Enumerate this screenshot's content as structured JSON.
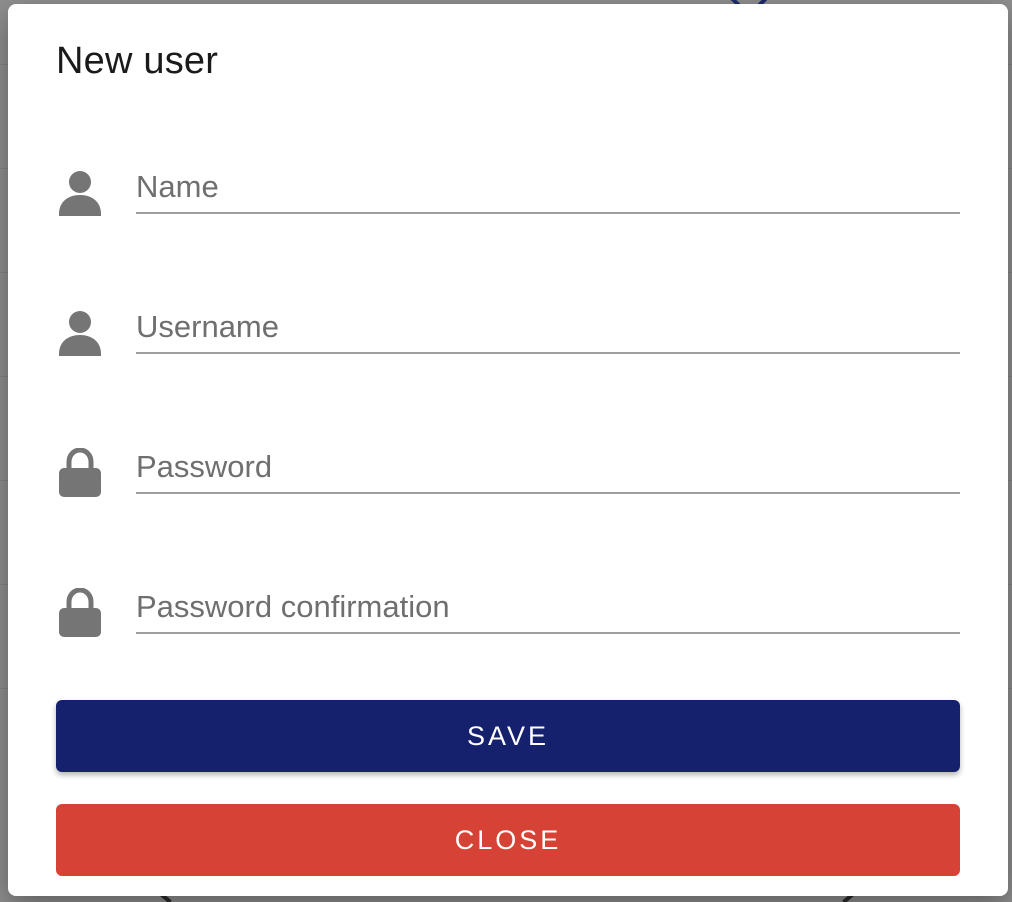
{
  "dialog": {
    "title": "New user"
  },
  "fields": [
    {
      "placeholder": "Name",
      "value": "",
      "icon": "person-icon",
      "type": "text"
    },
    {
      "placeholder": "Username",
      "value": "",
      "icon": "person-icon",
      "type": "text"
    },
    {
      "placeholder": "Password",
      "value": "",
      "icon": "lock-icon",
      "type": "password"
    },
    {
      "placeholder": "Password confirmation",
      "value": "",
      "icon": "lock-icon",
      "type": "password"
    }
  ],
  "actions": {
    "save_label": "SAVE",
    "close_label": "CLOSE"
  },
  "colors": {
    "primary": "#15216d",
    "danger": "#d64336",
    "icon": "#757575",
    "input_underline": "#9e9e9e"
  }
}
